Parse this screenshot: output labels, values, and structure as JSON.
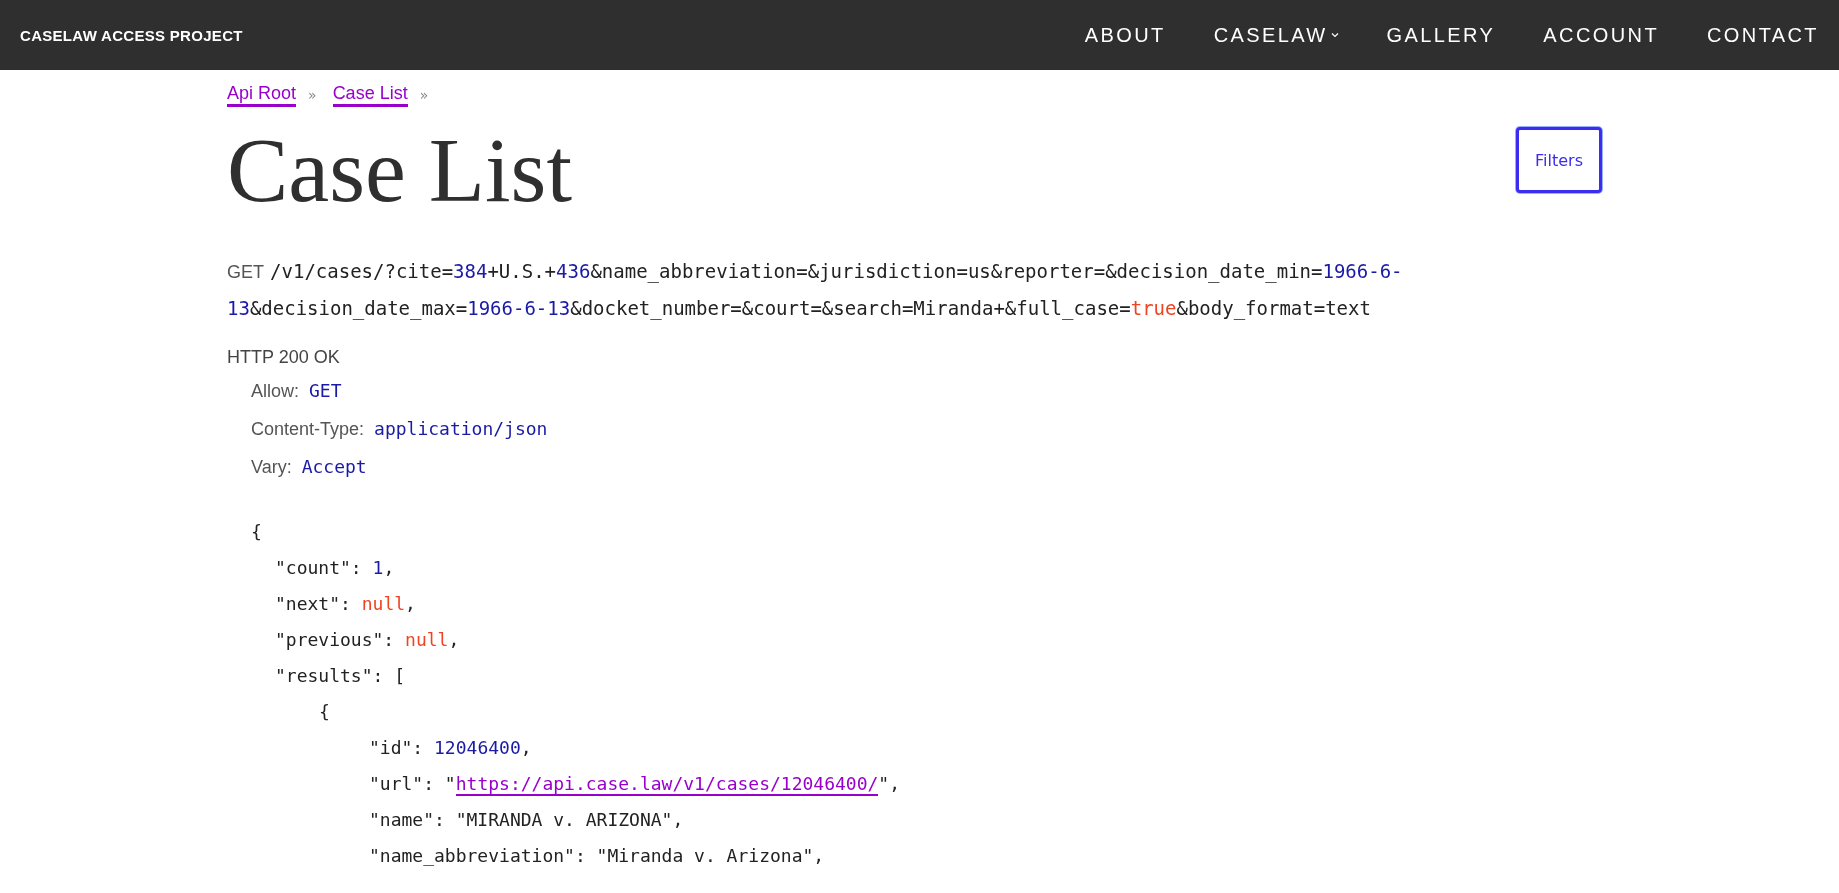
{
  "header": {
    "logo": "CASELAW ACCESS PROJECT",
    "nav": [
      {
        "label": "ABOUT",
        "dropdown": false
      },
      {
        "label": "CASELAW",
        "dropdown": true
      },
      {
        "label": "GALLERY",
        "dropdown": false
      },
      {
        "label": "ACCOUNT",
        "dropdown": false
      },
      {
        "label": "CONTACT",
        "dropdown": false
      }
    ]
  },
  "breadcrumbs": [
    {
      "label": "Api Root",
      "separator": "»"
    },
    {
      "label": "Case List",
      "separator": "»"
    }
  ],
  "title": "Case List",
  "filters_button": "Filters",
  "request": {
    "method": "GET",
    "url": [
      {
        "kind": "plain",
        "text": "/v1/cases/?cite="
      },
      {
        "kind": "number",
        "text": "384"
      },
      {
        "kind": "plain",
        "text": "+U.S.+"
      },
      {
        "kind": "number",
        "text": "436"
      },
      {
        "kind": "plain",
        "text": "&name_abbreviation=&jurisdiction=us&reporter=&decision_date_min="
      },
      {
        "kind": "number",
        "text": "1966-6-13"
      },
      {
        "kind": "plain",
        "text": "&decision_date_max="
      },
      {
        "kind": "number",
        "text": "1966-6-13"
      },
      {
        "kind": "plain",
        "text": "&docket_number=&court=&search=Miranda+&full_case="
      },
      {
        "kind": "literal",
        "text": "true"
      },
      {
        "kind": "plain",
        "text": "&body_format=text"
      }
    ]
  },
  "response": {
    "status": "HTTP 200 OK",
    "headers": [
      {
        "name": "Allow:",
        "value": "GET"
      },
      {
        "name": "Content-Type:",
        "value": "application/json"
      },
      {
        "name": "Vary:",
        "value": "Accept"
      }
    ],
    "body": {
      "tokens": [
        {
          "kind": "plain",
          "text": "{"
        }
      ],
      "children": [
        {
          "tokens": [
            {
              "kind": "plain",
              "text": "\"count\": "
            },
            {
              "kind": "number",
              "text": "1"
            },
            {
              "kind": "plain",
              "text": ","
            }
          ]
        },
        {
          "tokens": [
            {
              "kind": "plain",
              "text": "\"next\": "
            },
            {
              "kind": "literal",
              "text": "null"
            },
            {
              "kind": "plain",
              "text": ","
            }
          ]
        },
        {
          "tokens": [
            {
              "kind": "plain",
              "text": "\"previous\": "
            },
            {
              "kind": "literal",
              "text": "null"
            },
            {
              "kind": "plain",
              "text": ","
            }
          ]
        },
        {
          "tokens": [
            {
              "kind": "plain",
              "text": "\"results\": ["
            }
          ],
          "children": [
            {
              "tokens": [
                {
                  "kind": "plain",
                  "text": "{"
                }
              ],
              "children": [
                {
                  "tokens": [
                    {
                      "kind": "plain",
                      "text": "\"id\": "
                    },
                    {
                      "kind": "number",
                      "text": "12046400"
                    },
                    {
                      "kind": "plain",
                      "text": ","
                    }
                  ]
                },
                {
                  "tokens": [
                    {
                      "kind": "plain",
                      "text": "\"url\": \""
                    },
                    {
                      "kind": "link",
                      "text": "https://api.case.law/v1/cases/12046400/"
                    },
                    {
                      "kind": "plain",
                      "text": "\","
                    }
                  ]
                },
                {
                  "tokens": [
                    {
                      "kind": "plain",
                      "text": "\"name\": \"MIRANDA v. ARIZONA\","
                    }
                  ]
                },
                {
                  "tokens": [
                    {
                      "kind": "plain",
                      "text": "\"name_abbreviation\": \"Miranda v. Arizona\","
                    }
                  ]
                }
              ]
            }
          ]
        }
      ]
    }
  }
}
